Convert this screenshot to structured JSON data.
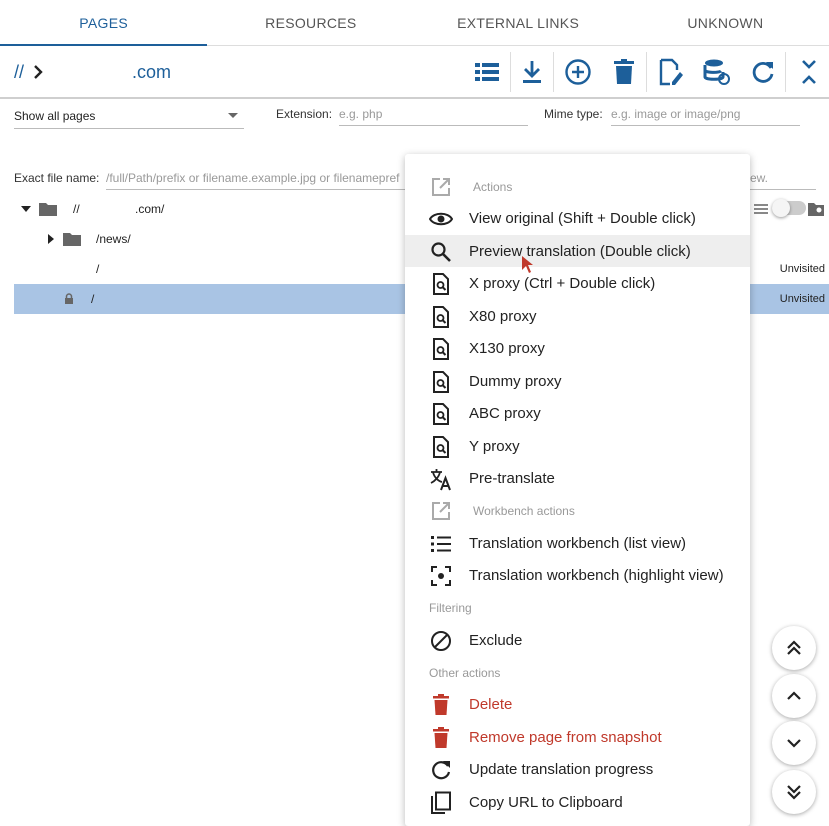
{
  "tabs": [
    {
      "label": "PAGES"
    },
    {
      "label": "RESOURCES"
    },
    {
      "label": "EXTERNAL LINKS"
    },
    {
      "label": "UNKNOWN"
    }
  ],
  "breadcrumb": {
    "root": "//",
    "domain": ".com"
  },
  "filters": {
    "page_filter": "Show all pages",
    "extension_label": "Extension:",
    "extension_placeholder": "e.g. php",
    "mime_label": "Mime type:",
    "mime_placeholder": "e.g. image or image/png",
    "exact_label": "Exact file name:",
    "exact_placeholder": "/full/Path/prefix or filename.example.jpg or filenamepref",
    "exact_trailing": "ew."
  },
  "tree": {
    "root_label": "//",
    "root_domain": ".com/",
    "rows": [
      {
        "label": "/news/",
        "status": ""
      },
      {
        "label": "/",
        "status": "Unvisited"
      },
      {
        "label": "/",
        "status": "Unvisited"
      }
    ]
  },
  "menu": {
    "actions_header": "Actions",
    "workbench_header": "Workbench actions",
    "filtering_header": "Filtering",
    "other_header": "Other actions",
    "items": [
      {
        "label": "View original (Shift + Double click)",
        "icon": "eye-icon"
      },
      {
        "label": "Preview translation (Double click)",
        "icon": "search-icon"
      },
      {
        "label": "X proxy (Ctrl + Double click)",
        "icon": "doc-search-icon"
      },
      {
        "label": "X80 proxy",
        "icon": "doc-search-icon"
      },
      {
        "label": "X130 proxy",
        "icon": "doc-search-icon"
      },
      {
        "label": "Dummy proxy",
        "icon": "doc-search-icon"
      },
      {
        "label": "ABC proxy",
        "icon": "doc-search-icon"
      },
      {
        "label": "Y proxy",
        "icon": "doc-search-icon"
      },
      {
        "label": "Pre-translate",
        "icon": "translate-icon"
      },
      {
        "label": "Translation workbench (list view)",
        "icon": "list-icon"
      },
      {
        "label": "Translation workbench (highlight view)",
        "icon": "focus-icon"
      },
      {
        "label": "Exclude",
        "icon": "block-icon"
      },
      {
        "label": "Delete",
        "icon": "trash-icon"
      },
      {
        "label": "Remove page from snapshot",
        "icon": "trash-icon"
      },
      {
        "label": "Update translation progress",
        "icon": "refresh-icon"
      },
      {
        "label": "Copy URL to Clipboard",
        "icon": "copy-icon"
      }
    ]
  },
  "colors": {
    "accent": "#1d5f9a",
    "selected_row": "#a9c4e4",
    "danger": "#c0392b"
  }
}
